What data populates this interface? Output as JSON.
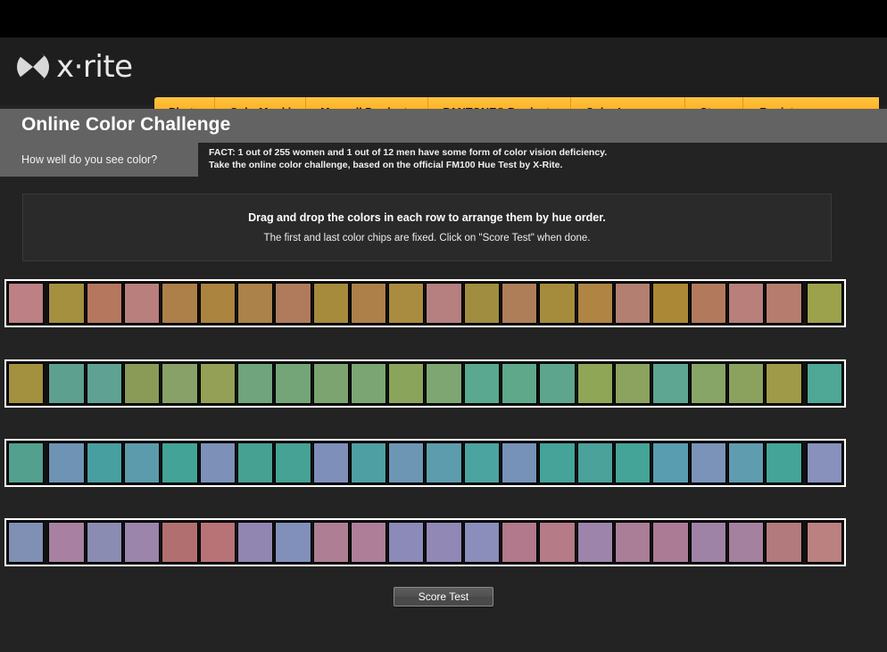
{
  "brand": {
    "logo_text": "x·rite",
    "logo_icon": "xrite-logo-icon"
  },
  "nav": {
    "items": [
      {
        "label": "Photo"
      },
      {
        "label": "ColorMunki"
      },
      {
        "label": "Munsell Products"
      },
      {
        "label": "PANTONE® Products"
      },
      {
        "label": "Color Language"
      },
      {
        "label": "Store"
      },
      {
        "label": "Register"
      }
    ]
  },
  "header": {
    "title": "Online Color Challenge",
    "tagline": "How well do you see color?",
    "fact_line_1": "FACT: 1 out of 255 women and 1 out of 12 men have some form of color vision deficiency.",
    "fact_line_2": "Take the online color challenge, based on the official FM100 Hue Test by X-Rite."
  },
  "instructions": {
    "primary": "Drag and drop the colors in each row to arrange them by hue order.",
    "secondary": "The first and last color chips are fixed. Click on \"Score Test\" when done."
  },
  "actions": {
    "score_test_label": "Score Test"
  },
  "colors": {
    "page_background": "#232323",
    "nav_accent": "#ffb01e",
    "titlebar_gray": "#636363",
    "row_border": "#ffffff"
  },
  "color_rows": [
    {
      "id": "row-1",
      "fixed_first": true,
      "fixed_last": true,
      "chips": [
        "#bd8084",
        "#a4903f",
        "#b5785f",
        "#b97f7c",
        "#ad7f49",
        "#ab8440",
        "#ab8249",
        "#b07b5c",
        "#a68b3c",
        "#ad8049",
        "#a98c3f",
        "#b5807f",
        "#a08d3f",
        "#ae7e59",
        "#a58c3d",
        "#b08443",
        "#b37f71",
        "#ab8835",
        "#b3795d",
        "#b87f7b",
        "#b67d6e",
        "#9ca14c"
      ]
    },
    {
      "id": "row-2",
      "fixed_first": true,
      "fixed_last": true,
      "chips": [
        "#a3913f",
        "#5ea08f",
        "#5fa294",
        "#8a9b58",
        "#87a169",
        "#93a055",
        "#6fa47c",
        "#73a578",
        "#7ba471",
        "#7ba573",
        "#8ba45c",
        "#7ea672",
        "#59a88f",
        "#5fa98a",
        "#5ea58d",
        "#8fa656",
        "#8ba35f",
        "#5ea592",
        "#87a567",
        "#8ba25f",
        "#9e9a48",
        "#4fa795"
      ]
    },
    {
      "id": "row-3",
      "fixed_first": true,
      "fixed_last": true,
      "chips": [
        "#53a08f",
        "#6e93b4",
        "#489fa0",
        "#5c9bab",
        "#43a396",
        "#7d90b8",
        "#46a193",
        "#45a294",
        "#7e90ba",
        "#4d9fa3",
        "#6d96b5",
        "#5c9cac",
        "#4ba4a0",
        "#7692b8",
        "#45a39a",
        "#4aa29a",
        "#44a497",
        "#599db1",
        "#7b93b9",
        "#5f9cb0",
        "#45a498",
        "#8791bb"
      ]
    },
    {
      "id": "row-4",
      "fixed_first": true,
      "fixed_last": true,
      "chips": [
        "#8090b5",
        "#a881a2",
        "#8b8cb1",
        "#9b85ab",
        "#b1706f",
        "#b87377",
        "#9186b1",
        "#8190bb",
        "#ae7e95",
        "#ae7e98",
        "#8b8ab8",
        "#9188b5",
        "#8b8dbb",
        "#b2788b",
        "#b57b87",
        "#9c84ab",
        "#aa7e97",
        "#ab7b96",
        "#9f83a7",
        "#a4819e",
        "#b27a7d",
        "#bb8180"
      ]
    }
  ]
}
